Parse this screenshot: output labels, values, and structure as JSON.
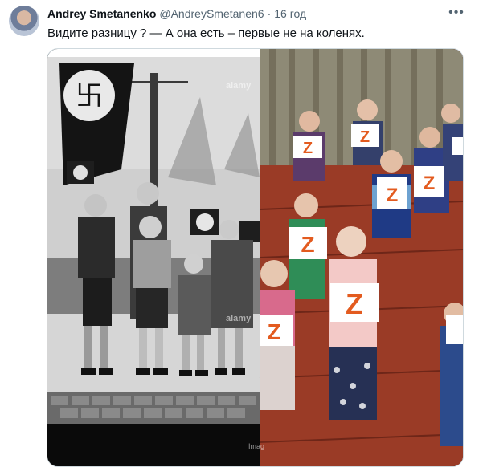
{
  "author": {
    "name": "Andrey Smetanenko",
    "handle": "@AndreySmetanen6",
    "separator": "·",
    "time": "16 год"
  },
  "tweet": {
    "text": "Видите разницу ? — А она есть – первые не на коленях."
  },
  "more_icon": "ellipsis-icon",
  "media": {
    "left_photo": {
      "watermark": "alamy",
      "caption": "Imag"
    },
    "right_photo": {
      "sign_letter": "Z"
    }
  }
}
